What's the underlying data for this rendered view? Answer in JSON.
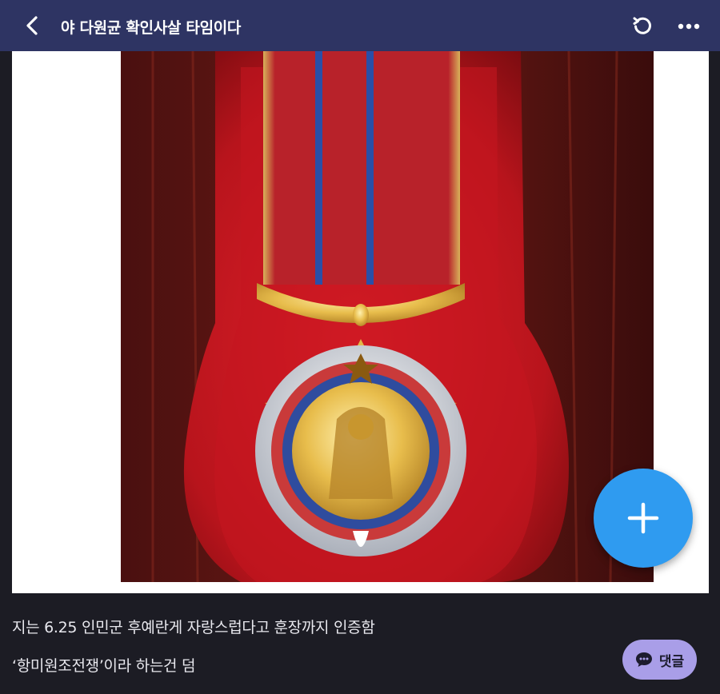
{
  "header": {
    "title": "야 다원균 확인사살 타임이다",
    "back_icon": "chevron-left-icon",
    "refresh_icon": "refresh-icon",
    "more_icon": "more-horizontal-icon"
  },
  "post": {
    "image_subject": "medal-photo",
    "captions": [
      "지는 6.25 인민군 후예란게 자랑스럽다고 훈장까지 인증함",
      "‘항미원조전쟁’이라 하는건 덤"
    ]
  },
  "fab": {
    "icon": "plus-icon"
  },
  "comment_button": {
    "label": "댓글",
    "icon": "chat-bubble-icon"
  },
  "colors": {
    "header_bg": "#2e3463",
    "page_bg": "#1c1c24",
    "fab_bg": "#2f9bf0",
    "comment_bg": "#a99ee8"
  }
}
